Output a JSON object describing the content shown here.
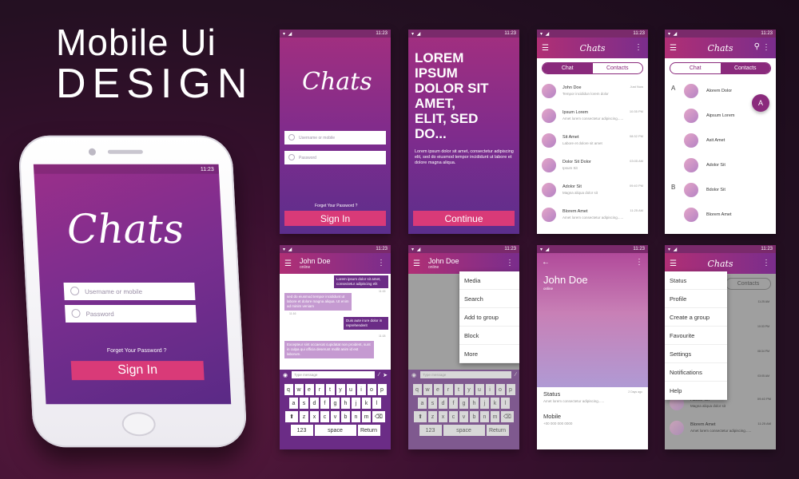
{
  "headline": {
    "line1": "Mobile Ui",
    "line2": "DESIGN"
  },
  "status_time": "11:23",
  "login": {
    "logo": "Chats",
    "username_placeholder": "Username or mobile",
    "password_placeholder": "Password",
    "forgot": "Forget Your Password ?",
    "signin": "Sign In"
  },
  "intro": {
    "heading_lines": [
      "LOREM",
      "IPSUM",
      "DOLOR SIT",
      "AMET,",
      "ELIT, SED",
      "DO..."
    ],
    "paragraph": "Lorem ipsum dolor sit amet, consectetur adipiscing elit, sed do eiusmod tempor incididunt ut labore et dolore magna aliqua.",
    "button": "Continue"
  },
  "chat_list": {
    "logo": "Chats",
    "tabs": [
      "Chat",
      "Contacts"
    ],
    "items": [
      {
        "name": "John Doe",
        "msg": "Tempor incididun lorem dolor",
        "time": "Just Now"
      },
      {
        "name": "Ipsum Lorem",
        "msg": "Amet lorem consectetur adipiscing......",
        "time": "10:35 PM"
      },
      {
        "name": "Sit Amet",
        "msg": "Labore et dolore sit amet",
        "time": "08:32 PM"
      },
      {
        "name": "Dolor Sit Dolor",
        "msg": "Ipsum Sit",
        "time": "03:05 AM"
      },
      {
        "name": "Adolor Sit",
        "msg": "Magna aliqua dolor sit",
        "time": "09:40 PM"
      },
      {
        "name": "Blorem Amet",
        "msg": "Amet lorem consectetur adipiscing......",
        "time": "11:25 AM"
      }
    ]
  },
  "contacts": {
    "logo": "Chats",
    "tabs": [
      "Chat",
      "Contacts"
    ],
    "index_letters": [
      "A",
      "B"
    ],
    "items": [
      "Alorem Dolor",
      "Aipsum Lorem",
      "Asit Amet",
      "Adolor Sit",
      "Bdolor Sit",
      "Blorem Amet"
    ],
    "fab": "A"
  },
  "conversation": {
    "name": "John Doe",
    "status": "online",
    "bubbles": [
      {
        "text": "Lorem ipsum dolor sit amet, consectetur adipiscing elit",
        "time": "11:15"
      },
      {
        "text": "sed do eiusmod tempor incididunt ut labore et dolore magna aliqua. Ut enim ad minim veniam",
        "time": "11:16"
      },
      {
        "text": "Duis aute irure dolor in reprehenderit",
        "time": "11:18"
      },
      {
        "text": "Excepteur sint occaecat cupidatat non proident, sunt in culpa qui officia deserunt mollit anim id est laborum.",
        "time": "11:22"
      }
    ],
    "input_placeholder": "Type message",
    "kb_row1": [
      "q",
      "w",
      "e",
      "r",
      "t",
      "y",
      "u",
      "i",
      "o",
      "p"
    ],
    "kb_row2": [
      "a",
      "s",
      "d",
      "f",
      "g",
      "h",
      "j",
      "k",
      "l"
    ],
    "kb_row3": [
      "z",
      "x",
      "c",
      "v",
      "b",
      "n",
      "m"
    ],
    "kb_123": "123",
    "kb_space": "space",
    "kb_return": "Return"
  },
  "menu_screen": {
    "items": [
      "Media",
      "Search",
      "Add to group",
      "Block",
      "More"
    ]
  },
  "profile": {
    "name": "John Doe",
    "status": "online",
    "status_label": "Status",
    "status_text": "Amet lorem consectetur adipiscing......",
    "status_time": "2 Days ago",
    "mobile_label": "Mobile",
    "mobile_number": "+00 000 000 0000"
  },
  "settings_menu": {
    "logo": "Chats",
    "items": [
      "Status",
      "Profile",
      "Create a group",
      "Favourite",
      "Settings",
      "Notifications",
      "Help"
    ],
    "contacts_tab": "Contacts",
    "bg_items": [
      {
        "name": "Adolor Sit",
        "msg": "Magna aliqua dolor sit",
        "time": "09:40 PM"
      },
      {
        "name": "Blorem Amet",
        "msg": "Amet lorem consectetur adipiscing......",
        "time": "11:25 AM"
      }
    ],
    "bg_times": [
      "11:25 AM",
      "10:33 PM",
      "08:34 PM",
      "03:05 AM",
      "09:40 PM",
      "11:25 AM"
    ]
  }
}
